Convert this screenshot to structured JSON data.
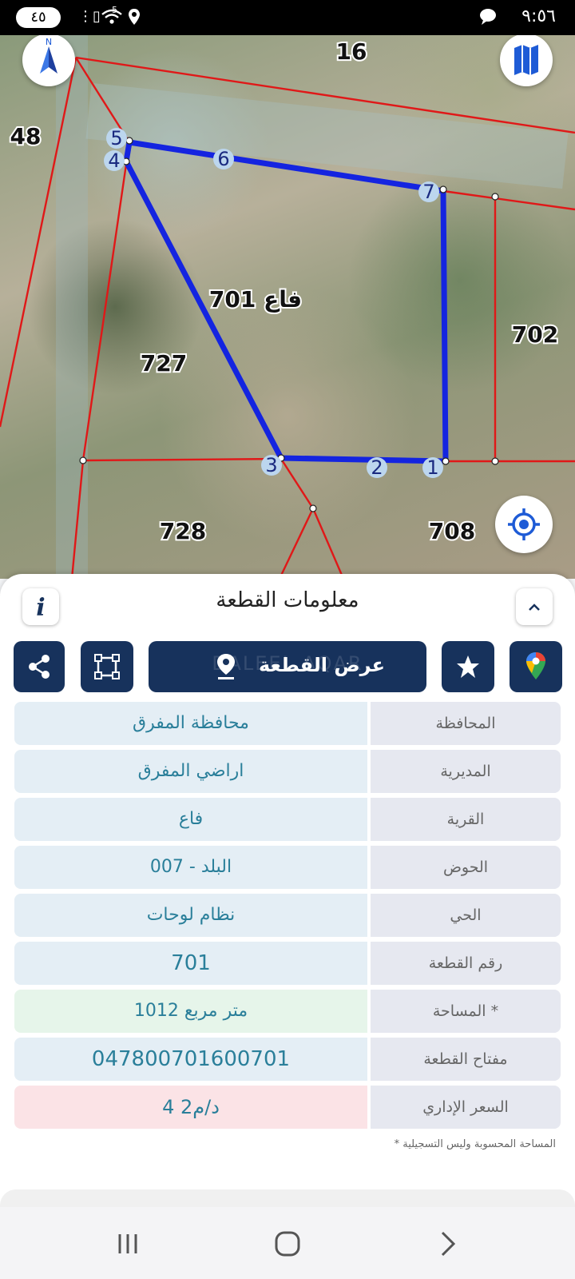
{
  "status_bar": {
    "badge": "٤٥",
    "signal_label": "5",
    "time": "٩:٥٦"
  },
  "map": {
    "parcel_labels": [
      {
        "id": "p16",
        "text": "16"
      },
      {
        "id": "p48",
        "text": "48"
      },
      {
        "id": "p701",
        "text": "فاع 701"
      },
      {
        "id": "p702",
        "text": "702"
      },
      {
        "id": "p727",
        "text": "727"
      },
      {
        "id": "p728",
        "text": "728"
      },
      {
        "id": "p708",
        "text": "708"
      }
    ],
    "vertex_labels": [
      "1",
      "2",
      "3",
      "4",
      "5",
      "6",
      "7"
    ],
    "boundary_color": "#1424e0",
    "neighbor_line_color": "#e01818"
  },
  "sheet": {
    "title": "معلومات القطعة",
    "show_parcel_button": "عرض القطعة",
    "watermark": "DALEEL AQAR",
    "rows": [
      {
        "label": "المحافظة",
        "value": "محافظة المفرق",
        "bg": "#e4eef5"
      },
      {
        "label": "المديرية",
        "value": "اراضي المفرق",
        "bg": "#e4eef5"
      },
      {
        "label": "القرية",
        "value": "فاع",
        "bg": "#e4eef5"
      },
      {
        "label": "الحوض",
        "value": "البلد - 007",
        "bg": "#e4eef5"
      },
      {
        "label": "الحي",
        "value": "نظام لوحات",
        "bg": "#e4eef5"
      },
      {
        "label": "رقم القطعة",
        "value": "701",
        "bg": "#e4eef5"
      },
      {
        "label": "المساحة *",
        "value": "1012  متر مربع",
        "bg": "#e6f5ea"
      },
      {
        "label": "مفتاح القطعة",
        "value": "047800701600701",
        "bg": "#e4eef5"
      },
      {
        "label": "السعر الإداري",
        "value": "4 د/م2",
        "bg": "#fbe3e6"
      }
    ],
    "footnote": "* المساحة المحسوبة وليس التسجيلية"
  }
}
